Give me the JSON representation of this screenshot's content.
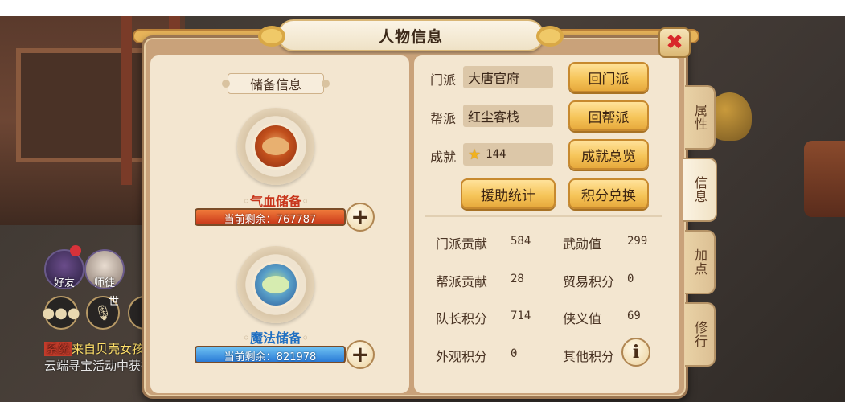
{
  "hud": {
    "friends_label": "好友",
    "apprentice_label": "师徒",
    "world_label": "世",
    "chat_line1_tag": "系统",
    "chat_line1_text": "来自贝壳女孩",
    "chat_line2_text": "云端寻宝活动中获得"
  },
  "dialog": {
    "title": "人物信息",
    "close_symbol": "✖"
  },
  "side_tabs": [
    {
      "label": "属性",
      "active": false
    },
    {
      "label": "信息",
      "active": true
    },
    {
      "label": "加点",
      "active": false
    },
    {
      "label": "修行",
      "active": false
    }
  ],
  "reserve": {
    "section_title": "储备信息",
    "hp": {
      "label": "气血储备",
      "remaining_text": "当前剩余：767787",
      "color": "#c9381a"
    },
    "mp": {
      "label": "魔法储备",
      "remaining_text": "当前剩余：821978",
      "color": "#2a7ad6"
    },
    "plus_symbol": "+"
  },
  "profile": {
    "sect_label": "门派",
    "sect_value": "大唐官府",
    "return_sect_button": "回门派",
    "gang_label": "帮派",
    "gang_value": "红尘客栈",
    "return_gang_button": "回帮派",
    "achievement_label": "成就",
    "achievement_value": "144",
    "achievement_button": "成就总览",
    "aid_stats_button": "援助统计",
    "points_exchange_button": "积分兑换"
  },
  "stats": [
    {
      "label": "门派贡献",
      "value": "584"
    },
    {
      "label": "武勋值",
      "value": "299"
    },
    {
      "label": "帮派贡献",
      "value": "28"
    },
    {
      "label": "贸易积分",
      "value": "0"
    },
    {
      "label": "队长积分",
      "value": "714"
    },
    {
      "label": "侠义值",
      "value": "69"
    },
    {
      "label": "外观积分",
      "value": "0"
    },
    {
      "label": "其他积分",
      "value": ""
    }
  ],
  "info_symbol": "i",
  "colors": {
    "accent_gold": "#f6c55a",
    "panel_bg": "#f3e6d0",
    "close_red": "#d8262a"
  }
}
